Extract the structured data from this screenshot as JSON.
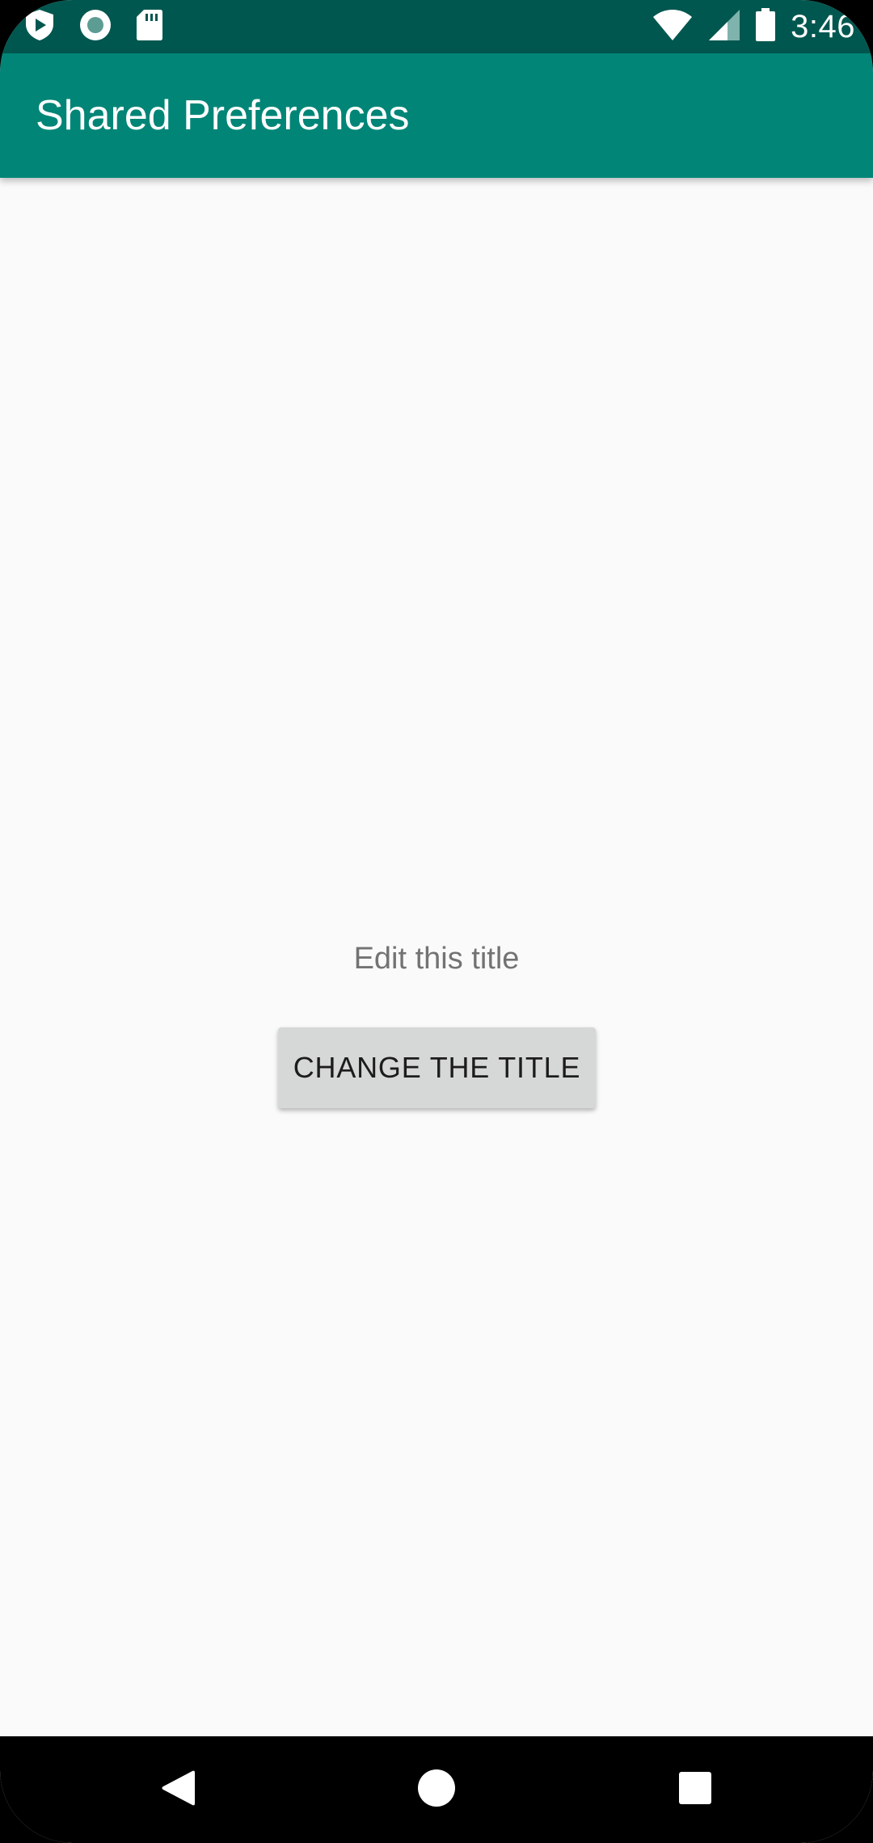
{
  "status_bar": {
    "time": "3:46",
    "left_icons": [
      "play-protect-icon",
      "sync-record-icon",
      "sd-card-icon"
    ],
    "right_icons": [
      "wifi-icon",
      "cell-signal-icon",
      "battery-icon"
    ]
  },
  "app_bar": {
    "title": "Shared Preferences"
  },
  "main": {
    "title_text": "Edit this title",
    "change_button_label": "CHANGE THE TITLE"
  },
  "nav_bar": {
    "buttons": [
      "back-icon",
      "home-icon",
      "recents-icon"
    ]
  },
  "colors": {
    "status_bar": "#00574f",
    "app_bar": "#008577",
    "background": "#fafafa",
    "button": "#d6d7d7",
    "secondary_text": "#737373"
  }
}
